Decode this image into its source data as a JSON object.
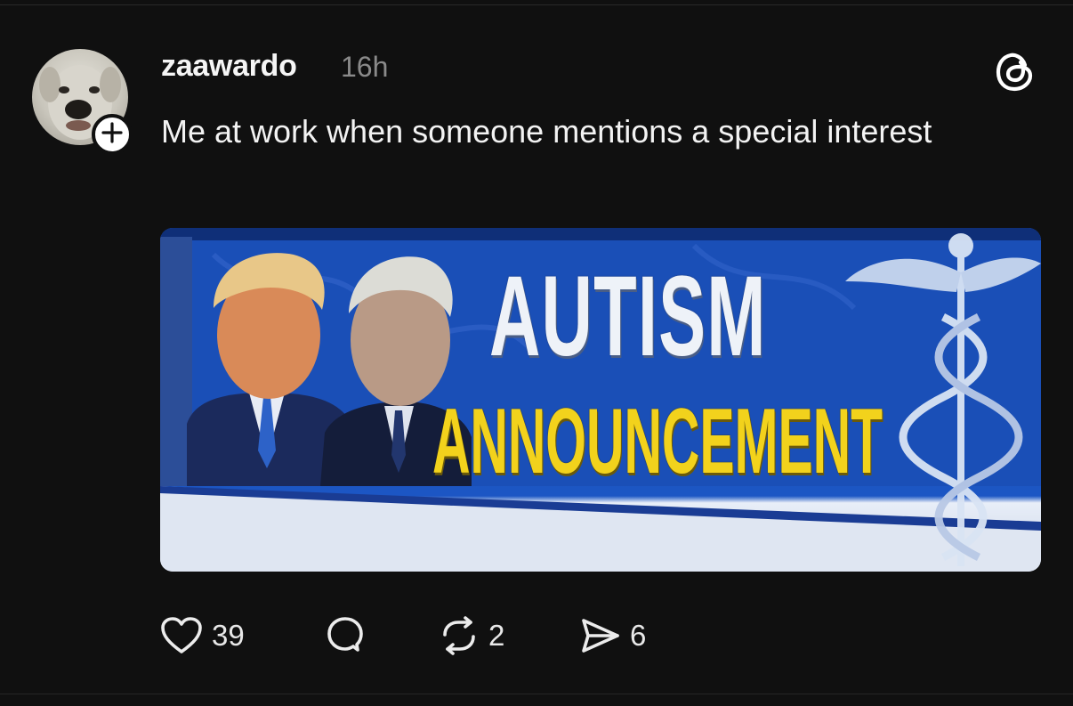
{
  "post": {
    "author": {
      "username": "zaawardo",
      "avatar_icon": "dog-avatar",
      "follow_icon": "plus-icon"
    },
    "time_ago": "16h",
    "text": "Me at work when someone mentions a special interest",
    "media": {
      "headline_line1": "AUTISM",
      "headline_line2": "ANNOUNCEMENT",
      "headline_line1_color": "#eef2f8",
      "headline_line2_color": "#f2d21c",
      "background_color": "#1a4fb7"
    }
  },
  "actions": {
    "like": {
      "icon": "heart-icon",
      "count": "39"
    },
    "reply": {
      "icon": "comment-icon"
    },
    "repost": {
      "icon": "repost-icon",
      "count": "2"
    },
    "share": {
      "icon": "send-icon",
      "count": "6"
    }
  },
  "app": {
    "logo_icon": "threads-logo-icon"
  },
  "colors": {
    "background": "#101010",
    "text": "#f3f3f3",
    "muted": "#8a8a8a"
  }
}
